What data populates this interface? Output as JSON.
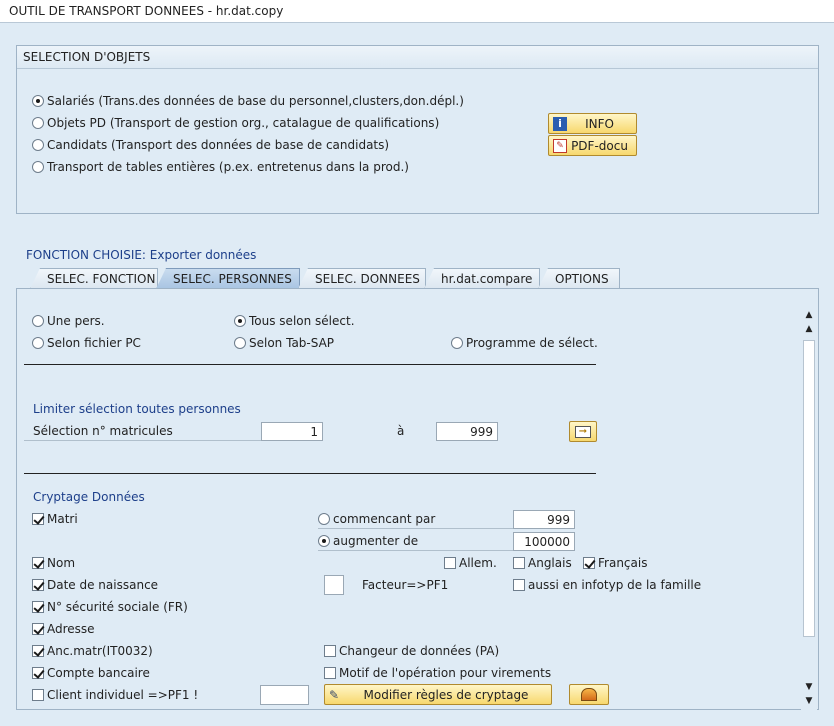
{
  "window": {
    "title": "OUTIL DE TRANSPORT DONNEES - hr.dat.copy"
  },
  "object_selection": {
    "title": "SELECTION D'OBJETS",
    "options": [
      {
        "label": "Salariés (Trans.des données de base du personnel,clusters,don.dépl.)",
        "selected": true
      },
      {
        "label": "Objets PD (Transport de gestion org., catalague de qualifications)",
        "selected": false
      },
      {
        "label": "Candidats (Transport des données de base de candidats)",
        "selected": false
      },
      {
        "label": "Transport de tables entières (p.ex. entretenus dans la prod.)",
        "selected": false
      }
    ],
    "info_button": "INFO",
    "pdf_button": "PDF-docu"
  },
  "function": {
    "label": "FONCTION CHOISIE: Exporter données"
  },
  "tabs": [
    {
      "label": "SELEC. FONCTION",
      "active": false
    },
    {
      "label": "SELEC. PERSONNES",
      "active": true
    },
    {
      "label": "SELEC. DONNEES",
      "active": false
    },
    {
      "label": "hr.dat.compare",
      "active": false
    },
    {
      "label": "OPTIONS",
      "active": false
    }
  ],
  "person_selection": {
    "options": [
      {
        "label": "Une pers.",
        "selected": false
      },
      {
        "label": "Tous selon sélect.",
        "selected": true
      },
      {
        "label": "Selon fichier PC",
        "selected": false
      },
      {
        "label": "Selon Tab-SAP",
        "selected": false
      },
      {
        "label": "Programme de sélect.",
        "selected": false
      }
    ]
  },
  "limit": {
    "title": "Limiter sélection toutes personnes",
    "label": "Sélection n° matricules",
    "from": "1",
    "to_label": "à",
    "to": "999"
  },
  "crypt": {
    "title": "Cryptage Données",
    "matri": "Matri",
    "start_label": "commencant par",
    "start_value": "999",
    "increase_label": "augmenter de",
    "increase_value": "100000",
    "nom": "Nom",
    "lang_allem": "Allem.",
    "lang_anglais": "Anglais",
    "lang_francais": "Français",
    "birth": "Date de naissance",
    "factor": "Facteur=>PF1",
    "family": "aussi en infotyp de la famille",
    "social": "N° sécurité sociale (FR)",
    "address": "Adresse",
    "anc": "Anc.matr(IT0032)",
    "changer": "Changeur de données (PA)",
    "bank": "Compte bancaire",
    "motif": "Motif de l'opération pour virements",
    "client": "Client individuel =>PF1 !",
    "modify_button": "Modifier règles de cryptage"
  },
  "colors": {
    "background": "#dfebf5",
    "button": "#f7d86e",
    "heading": "#1d3f8a"
  }
}
